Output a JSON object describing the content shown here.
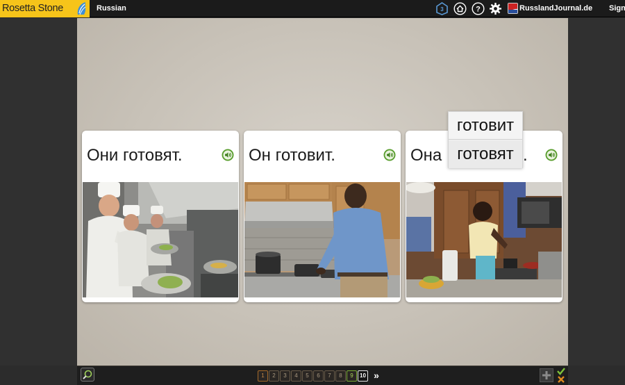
{
  "app": {
    "logo_text": "Rosetta Stone",
    "language": "Russian"
  },
  "topbar": {
    "icons": [
      "unit-badge-icon",
      "home-icon",
      "help-icon",
      "settings-icon"
    ],
    "site_label": "RusslandJournal.de",
    "sign_label": "Sign"
  },
  "cards": [
    {
      "text": "Они готовят.",
      "photo": "chefs-cooking-kitchen-photo"
    },
    {
      "text": "Он готовит.",
      "photo": "man-cooking-stove-photo"
    },
    {
      "text_start": "Она",
      "text_end": ".",
      "photo": "woman-cooking-kitchen-photo"
    }
  ],
  "choices": [
    "готовит",
    "готовят"
  ],
  "bottombar": {
    "pages": [
      "1",
      "2",
      "3",
      "4",
      "5",
      "6",
      "7",
      "8",
      "9",
      "10"
    ],
    "completed_page": "9",
    "current_page": "10",
    "next_symbol": "»"
  },
  "colors": {
    "logo_yellow": "#f6c41a",
    "topbar": "#1b1b1b",
    "stage": "#cfc9bf",
    "speaker_green": "#5a9e2f",
    "page_done": "#7eae37",
    "page_first": "#a66b2a"
  }
}
